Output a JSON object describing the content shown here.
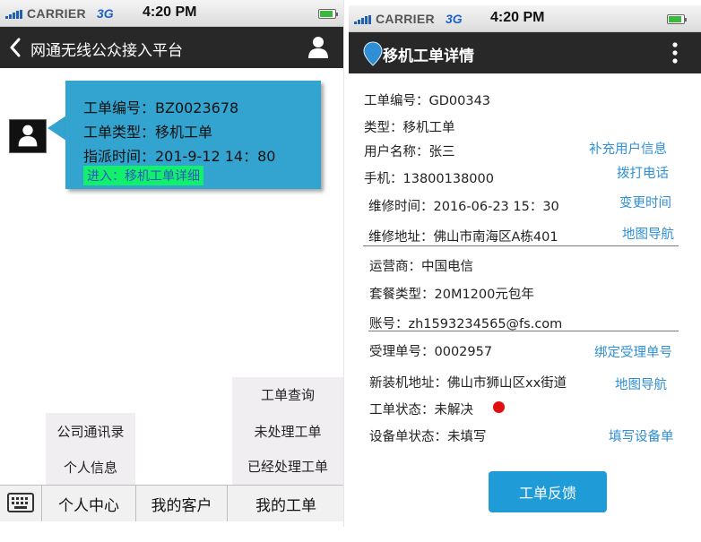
{
  "status_bar": {
    "carrier": "CARRIER",
    "network": "3G",
    "time": "4:20 PM"
  },
  "left_screen": {
    "title": "网通无线公众接入平台",
    "message": {
      "order_no": "工单编号：BZ0023678",
      "order_type": "工单类型：移机工单",
      "assign_time": "指派时间：201-9-12 14：80",
      "enter_link": "进入：移机工单详细"
    },
    "menus": {
      "order_query": "工单查询",
      "unprocessed": "未处理工单",
      "processed": "已经处理工单",
      "company_contacts": "公司通讯录",
      "personal_info": "个人信息"
    },
    "tabs": [
      "个人中心",
      "我的客户",
      "我的工单"
    ]
  },
  "right_screen": {
    "title": "移机工单详情",
    "fields": {
      "order_no": "工单编号：GD00343",
      "type": "类型：移机工单",
      "user_name": "用户名称：张三",
      "phone": "手机：13800138000",
      "repair_time": "维修时间：2016-06-23 15：30",
      "repair_address": "维修地址：佛山市南海区A栋401",
      "operator": "运营商：中国电信",
      "package": "套餐类型：20M1200元包年",
      "account": "账号：zh1593234565@fs.com",
      "accept_no": "受理单号：0002957",
      "new_address": "新装机地址：佛山市狮山区xx街道",
      "order_status": "工单状态：未解决",
      "device_status": "设备单状态：未填写"
    },
    "actions": {
      "add_user_info": "补充用户信息",
      "call": "拨打电话",
      "change_time": "变更时间",
      "map_nav_1": "地图导航",
      "bind_accept_no": "绑定受理单号",
      "map_nav_2": "地图导航",
      "fill_device": "填写设备单"
    },
    "feedback_button": "工单反馈",
    "colors": {
      "accent": "#2f8fd4",
      "status_unresolved": "#e01010"
    }
  }
}
